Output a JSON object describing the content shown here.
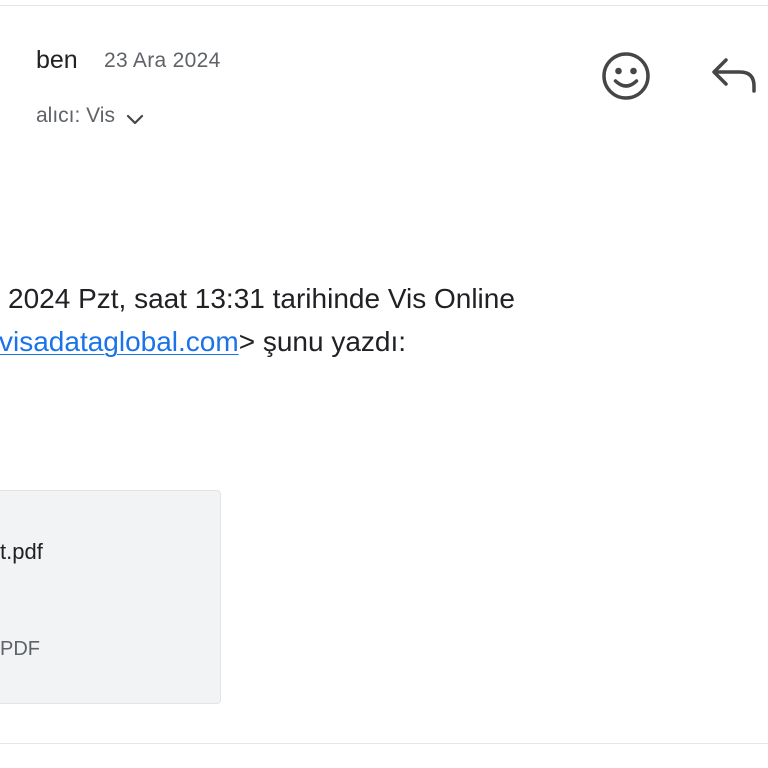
{
  "message": {
    "sender": "ben",
    "date": "23 Ara 2024",
    "recipient_label": "alıcı: Vis"
  },
  "actions": {
    "emoji_icon": "smiley-face-icon",
    "reply_icon": "reply-arrow-icon",
    "expand_icon": "chevron-down-icon"
  },
  "quote_header": {
    "line1": "2024 Pzt, saat 13:31 tarihinde Vis Online",
    "link_text": "visadataglobal.com",
    "line2_suffix": "> şunu yazdı:"
  },
  "attachment": {
    "name": "t.pdf",
    "type": "PDF"
  },
  "colors": {
    "link": "#1a73e8",
    "secondary_text": "#5f6368",
    "attachment_bg": "#f1f3f4"
  }
}
